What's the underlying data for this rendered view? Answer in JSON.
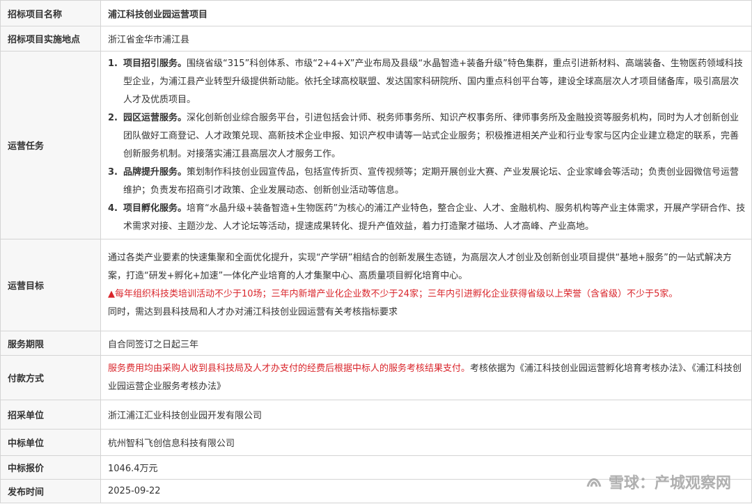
{
  "rows": {
    "name": {
      "label": "招标项目名称",
      "value": "浦江科技创业园运营项目"
    },
    "location": {
      "label": "招标项目实施地点",
      "value": "浙江省金华市浦江县"
    },
    "tasks": {
      "label": "运营任务",
      "items": [
        {
          "num": "1.",
          "title": "项目招引服务。",
          "text": "围绕省级“315”科创体系、市级“2+4+X”产业布局及县级“水晶智造+装备升级”特色集群，重点引进新材料、高端装备、生物医药领域科技型企业，为浦江县产业转型升级提供新动能。依托全球高校联盟、发达国家科研院所、国内重点科创平台等，建设全球高层次人才项目储备库，吸引高层次人才及优质项目。"
        },
        {
          "num": "2.",
          "title": "园区运营服务。",
          "text": "深化创新创业综合服务平台，引进包括会计师、税务师事务所、知识产权事务所、律师事务所及金融投资等服务机构，同时为人才创新创业团队做好工商登记、人才政策兑现、高新技术企业申报、知识产权申请等一站式企业服务；积极推进相关产业和行业专家与区内企业建立稳定的联系，完善创新服务机制。对接落实浦江县高层次人才服务工作。"
        },
        {
          "num": "3.",
          "title": "品牌提升服务。",
          "text": "策划制作科技创业园宣传品，包括宣传折页、宣传视频等；定期开展创业大赛、产业发展论坛、企业家峰会等活动；负责创业园微信号运营维护；负责发布招商引才政策、企业发展动态、创新创业活动等信息。"
        },
        {
          "num": "4.",
          "title": "项目孵化服务。",
          "text": "培育“水晶升级+装备智造+生物医药”为核心的浦江产业特色，整合企业、人才、金融机构、服务机构等产业主体需求，开展产学研合作、技术需求对接、主题沙龙、人才论坛等活动，提速成果转化、提升产值效益，着力打造聚才磁场、人才高峰、产业高地。"
        }
      ]
    },
    "goal": {
      "label": "运营目标",
      "para1": "通过各类产业要素的快速集聚和全面优化提升，实现“产学研”相结合的创新发展生态链，为高层次人才创业及创新创业项目提供“基地+服务”的一站式解决方案，打造“研发+孵化+加速”一体化产业培育的人才集聚中心、高质量项目孵化培育中心。",
      "para2": "▲每年组织科技类培训活动不少于10场；三年内新增产业化企业数不少于24家；三年内引进孵化企业获得省级以上荣誉（含省级）不少于5家。",
      "para3": "同时，需达到县科技局和人才办对浦江科技创业园运营有关考核指标要求"
    },
    "period": {
      "label": "服务期限",
      "value": "自合同签订之日起三年"
    },
    "payment": {
      "label": "付款方式",
      "red": "服务费用均由采购人收到县科技局及人才办支付的经费后根据中标人的服务考核结果支付。",
      "text": "考核依据为《浦江科技创业园运营孵化培育考核办法》、《浦江科技创业园运营企业服务考核办法》"
    },
    "buyer": {
      "label": "招采单位",
      "value": "浙江浦江汇业科技创业园开发有限公司"
    },
    "winner": {
      "label": "中标单位",
      "value": "杭州智科飞创信息科技有限公司"
    },
    "price": {
      "label": "中标报价",
      "value": "1046.4万元"
    },
    "date": {
      "label": "发布时间",
      "value": "2025-09-22"
    }
  },
  "watermark": {
    "text": "雪球：产城观察网",
    "icon": "xueqiu-logo-icon"
  },
  "colors": {
    "red": "#d9252b",
    "label_bg": "#f7f7f7",
    "border": "#d4d4d4"
  }
}
